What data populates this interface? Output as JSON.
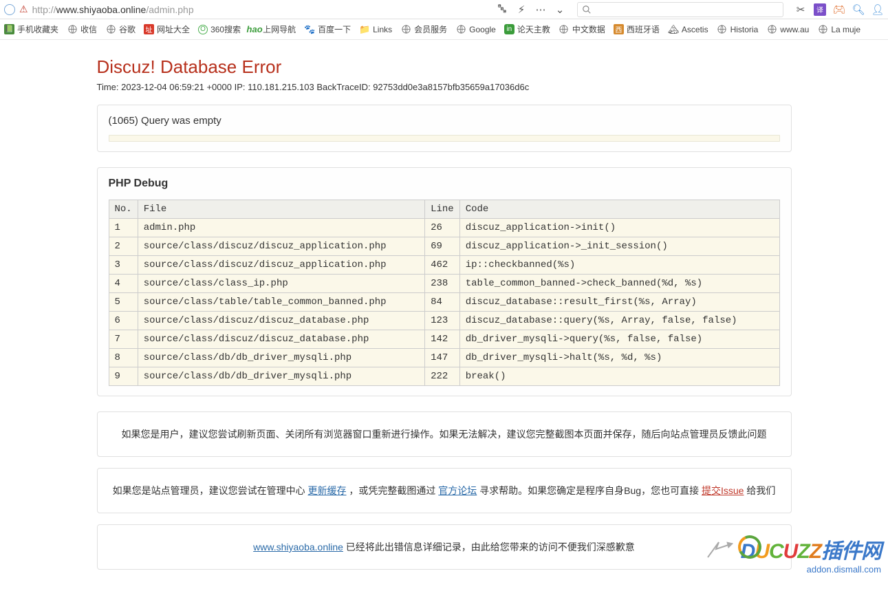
{
  "url": {
    "prefix": "http://",
    "dark": "www.shiyaoba.online",
    "suffix": "/admin.php"
  },
  "bookmarks": [
    {
      "icon": "book",
      "label": "手机收藏夹"
    },
    {
      "icon": "globe",
      "label": "收信"
    },
    {
      "icon": "globe",
      "label": "谷歌"
    },
    {
      "icon": "sq-red",
      "label": "网址大全"
    },
    {
      "icon": "circ-o",
      "label": "360搜索"
    },
    {
      "icon": "hao",
      "label": "上网导航"
    },
    {
      "icon": "paw",
      "label": "百度一下"
    },
    {
      "icon": "folder",
      "label": "Links"
    },
    {
      "icon": "globe",
      "label": "会员服务"
    },
    {
      "icon": "globe",
      "label": "Google"
    },
    {
      "icon": "sq-green",
      "label": "论天主教"
    },
    {
      "icon": "globe",
      "label": "中文数据"
    },
    {
      "icon": "sq-or",
      "label": "西班牙语"
    },
    {
      "icon": "mnt",
      "label": "Ascetis"
    },
    {
      "icon": "globe",
      "label": "Historia"
    },
    {
      "icon": "globe",
      "label": "www.au"
    },
    {
      "icon": "globe",
      "label": "La muje"
    }
  ],
  "page": {
    "title": "Discuz! Database Error",
    "meta": "Time: 2023-12-04 06:59:21 +0000 IP: 110.181.215.103 BackTraceID: 92753dd0e3a8157bfb35659a17036d6c",
    "query": "(1065) Query was empty",
    "debug_title": "PHP Debug",
    "headers": {
      "no": "No.",
      "file": "File",
      "line": "Line",
      "code": "Code"
    },
    "rows": [
      {
        "no": "1",
        "file": "admin.php",
        "line": "26",
        "code": "discuz_application->init()"
      },
      {
        "no": "2",
        "file": "source/class/discuz/discuz_application.php",
        "line": "69",
        "code": "discuz_application->_init_session()"
      },
      {
        "no": "3",
        "file": "source/class/discuz/discuz_application.php",
        "line": "462",
        "code": "ip::checkbanned(%s)"
      },
      {
        "no": "4",
        "file": "source/class/class_ip.php",
        "line": "238",
        "code": "table_common_banned->check_banned(%d, %s)"
      },
      {
        "no": "5",
        "file": "source/class/table/table_common_banned.php",
        "line": "84",
        "code": "discuz_database::result_first(%s, Array)"
      },
      {
        "no": "6",
        "file": "source/class/discuz/discuz_database.php",
        "line": "123",
        "code": "discuz_database::query(%s, Array, false, false)"
      },
      {
        "no": "7",
        "file": "source/class/discuz/discuz_database.php",
        "line": "142",
        "code": "db_driver_mysqli->query(%s, false, false)"
      },
      {
        "no": "8",
        "file": "source/class/db/db_driver_mysqli.php",
        "line": "147",
        "code": "db_driver_mysqli->halt(%s, %d, %s)"
      },
      {
        "no": "9",
        "file": "source/class/db/db_driver_mysqli.php",
        "line": "222",
        "code": "break()"
      }
    ],
    "msg1": "如果您是用户，建议您尝试刷新页面、关闭所有浏览器窗口重新进行操作。如果无法解决，建议您完整截图本页面并保存，随后向站点管理员反馈此问题",
    "msg2_a": "如果您是站点管理员，建议您尝试在管理中心 ",
    "msg2_link1": "更新缓存",
    "msg2_b": " ，或凭完整截图通过 ",
    "msg2_link2": "官方论坛",
    "msg2_c": " 寻求帮助。如果您确定是程序自身Bug，您也可直接 ",
    "msg2_link3": "提交Issue",
    "msg2_d": " 给我们",
    "msg3_link": "www.shiyaoba.online",
    "msg3_b": " 已经将此出错信息详细记录，由此给您带来的访问不便我们深感歉意"
  },
  "watermark": {
    "main": "DUCUZZ插件网",
    "sub": "addon.dismall.com"
  }
}
